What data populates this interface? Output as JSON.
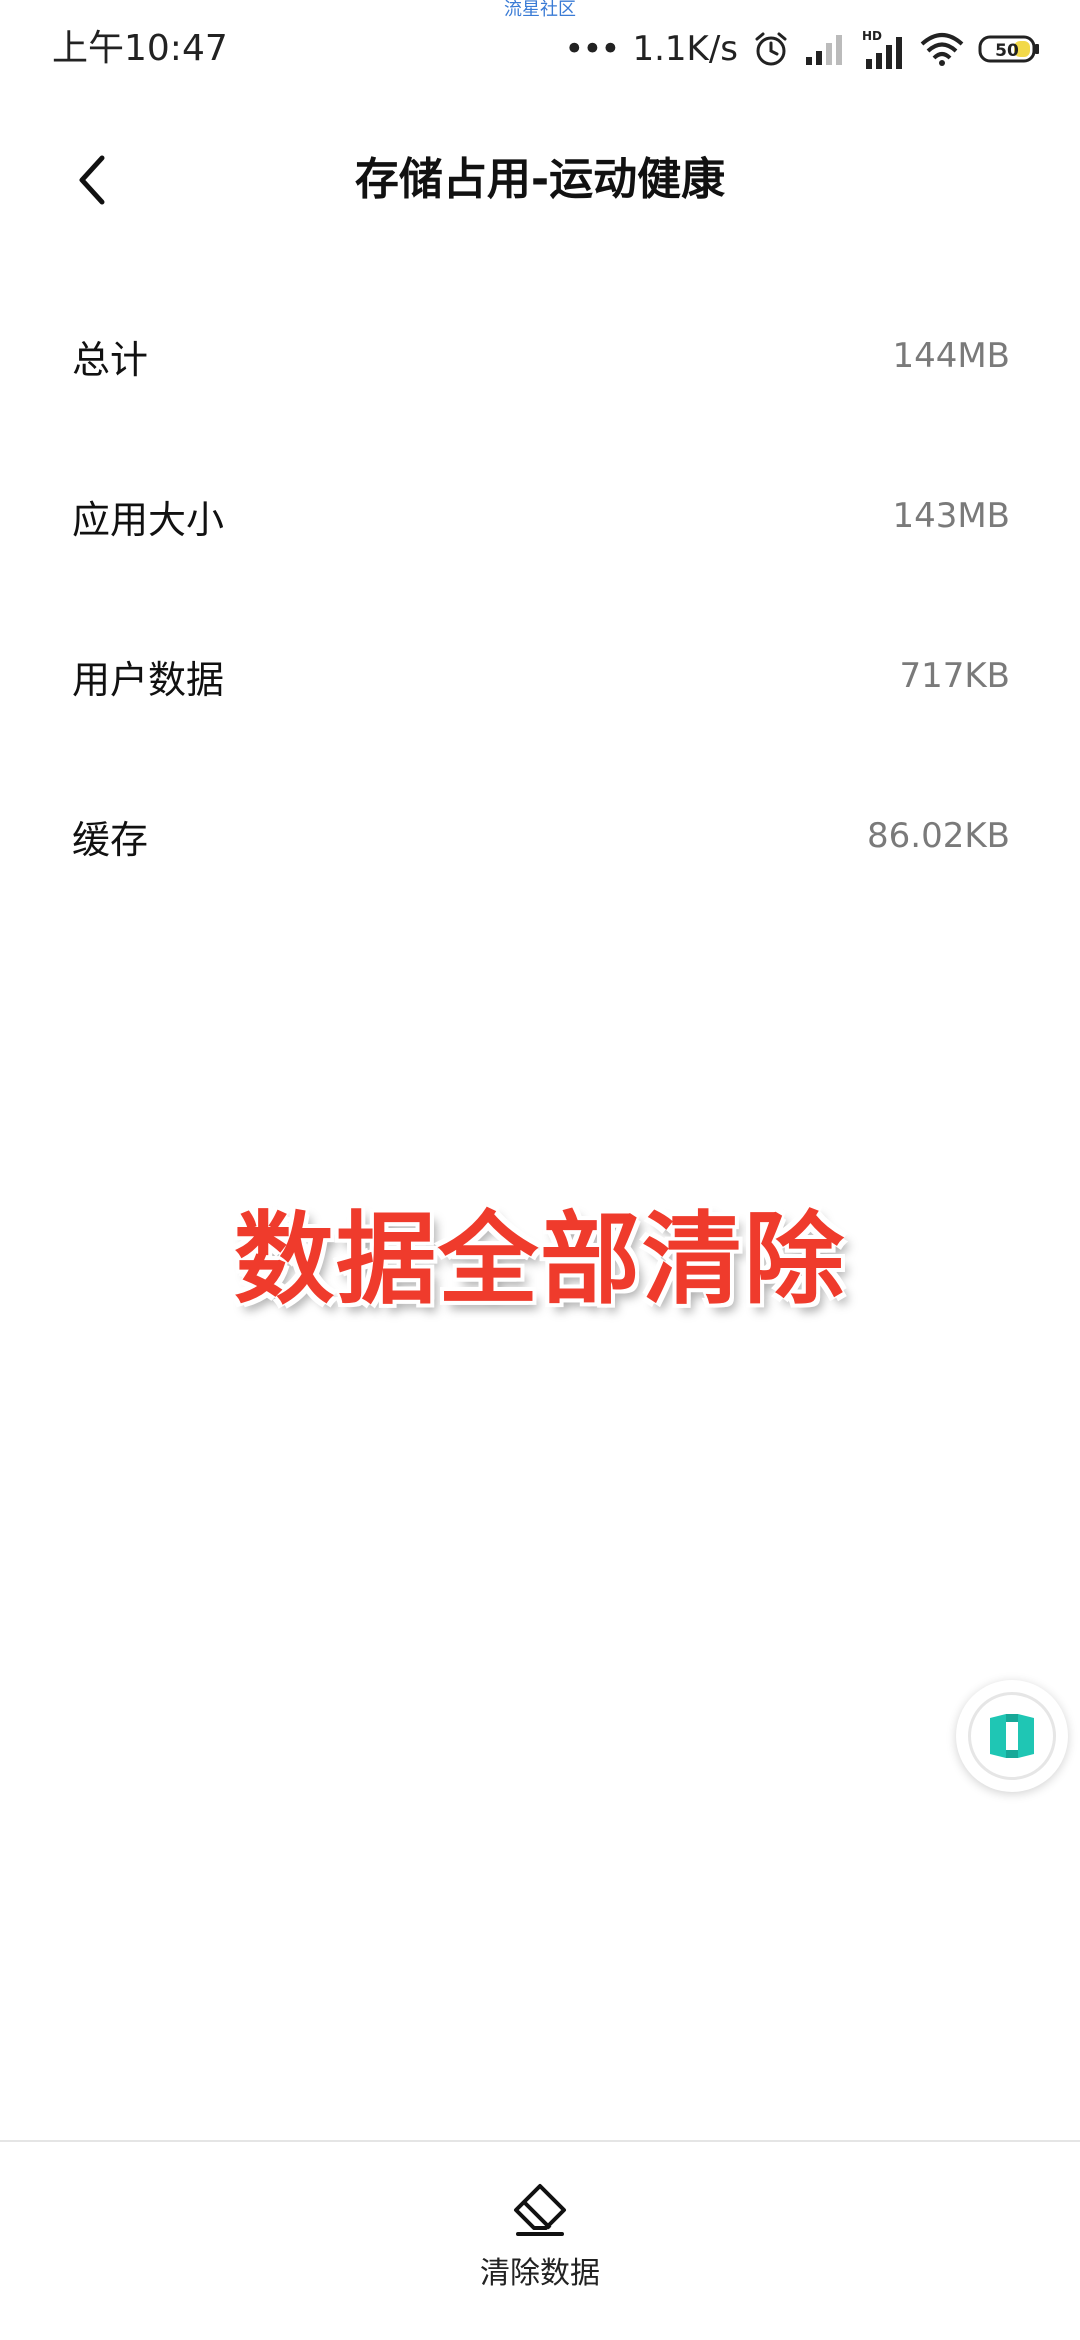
{
  "status_bar": {
    "watermark": "流星社区",
    "time": "上午10:47",
    "dots": "•••",
    "network_speed": "1.1K/s",
    "hd_label": "HD",
    "battery_level": "50",
    "icons": [
      "alarm-icon",
      "signal-weak-icon",
      "signal-hd-icon",
      "wifi-icon",
      "battery-icon"
    ]
  },
  "header": {
    "back_icon": "chevron-left-icon",
    "title": "存储占用-运动健康"
  },
  "storage_items": [
    {
      "label": "总计",
      "value": "144MB"
    },
    {
      "label": "应用大小",
      "value": "143MB"
    },
    {
      "label": "用户数据",
      "value": "717KB"
    },
    {
      "label": "缓存",
      "value": "86.02KB"
    }
  ],
  "overlay": {
    "caption": "数据全部清除",
    "color": "#ef3b2c"
  },
  "floating_button": {
    "icon": "cube-icon",
    "accent": "#1fc6b4"
  },
  "bottom_bar": {
    "clear_icon": "eraser-icon",
    "clear_label": "清除数据"
  }
}
